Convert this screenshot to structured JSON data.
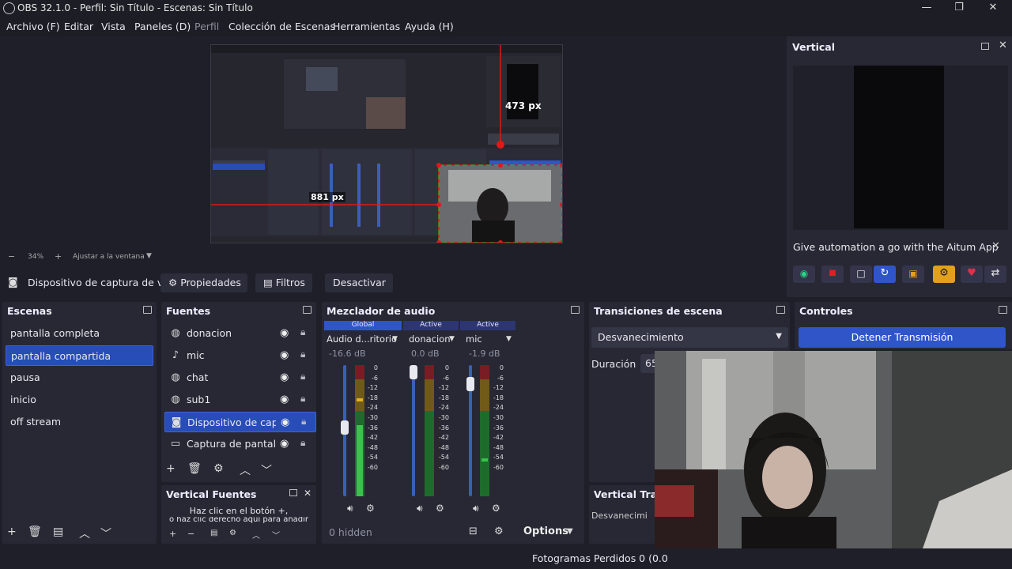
{
  "window": {
    "title": "OBS 32.1.0 - Perfil: Sin Título - Escenas: Sin Título",
    "controls": [
      "—",
      "❐",
      "✕"
    ]
  },
  "menu": [
    "Archivo (F)",
    "Editar",
    "Vista",
    "Paneles (D)",
    "Perfil",
    "Colección de Escenas",
    "Herramientas",
    "Ayuda (H)"
  ],
  "preview": {
    "label_vertical_px": "473 px",
    "label_horizontal_px": "881 px",
    "zoom": "34%",
    "fit_label": "Ajustar a la ventana"
  },
  "vertical_dock": {
    "title": "Vertical",
    "banner": "Give automation a go with the Aitum App",
    "tools": [
      "record-live-icon",
      "stop-icon",
      "square-icon",
      "refresh-icon",
      "cast-icon",
      "gear-icon",
      "heart-icon",
      "share-icon"
    ]
  },
  "source_toolbar": {
    "source_name": "Dispositivo de captura de v",
    "properties": "Propiedades",
    "filters": "Filtros",
    "deactivate": "Desactivar"
  },
  "scenes": {
    "title": "Escenas",
    "items": [
      "pantalla completa",
      "pantalla compartida",
      "pausa",
      "inicio",
      "off stream"
    ],
    "selected": 1
  },
  "sources": {
    "title": "Fuentes",
    "items": [
      {
        "icon": "donation-icon",
        "label": "donacion"
      },
      {
        "icon": "mic-icon",
        "label": "mic"
      },
      {
        "icon": "chat-icon",
        "label": "chat"
      },
      {
        "icon": "globe-icon",
        "label": "sub1"
      },
      {
        "icon": "camera-icon",
        "label": "Dispositivo de captu"
      },
      {
        "icon": "monitor-icon",
        "label": "Captura de pantalla"
      }
    ],
    "selected": 4
  },
  "vertical_sources": {
    "title": "Vertical Fuentes",
    "hint_line1": "Haz clic en el botón +,",
    "hint_line2": "o haz clic derecho aquí para añadir"
  },
  "mixer": {
    "title": "Mezclador de audio",
    "headers": [
      "Global",
      "Active",
      "Active"
    ],
    "channels": [
      {
        "name": "Audio d...ritorio",
        "db": "-16.6 dB",
        "fader_pct": 55
      },
      {
        "name": "donacion",
        "db": "0.0 dB",
        "fader_pct": 100
      },
      {
        "name": "mic",
        "db": "-1.9 dB",
        "fader_pct": 90
      }
    ],
    "scale": [
      "0",
      "-6",
      "-12",
      "-18",
      "-24",
      "-30",
      "-36",
      "-42",
      "-48",
      "-54",
      "-60"
    ],
    "hidden": "0 hidden",
    "options": "Options"
  },
  "transitions": {
    "title": "Transiciones de escena",
    "selected": "Desvanecimiento",
    "duration_label": "Duración",
    "duration_value": "65",
    "vertical_title": "Vertical Trar",
    "vertical_selected": "Desvanecimi"
  },
  "controls": {
    "title": "Controles",
    "stream_button": "Detener Transmisión"
  },
  "status": {
    "frames": "Fotogramas Perdidos 0 (0.0"
  },
  "colors": {
    "accent": "#284cb8",
    "panel": "#272834",
    "background": "#1e1f29"
  }
}
